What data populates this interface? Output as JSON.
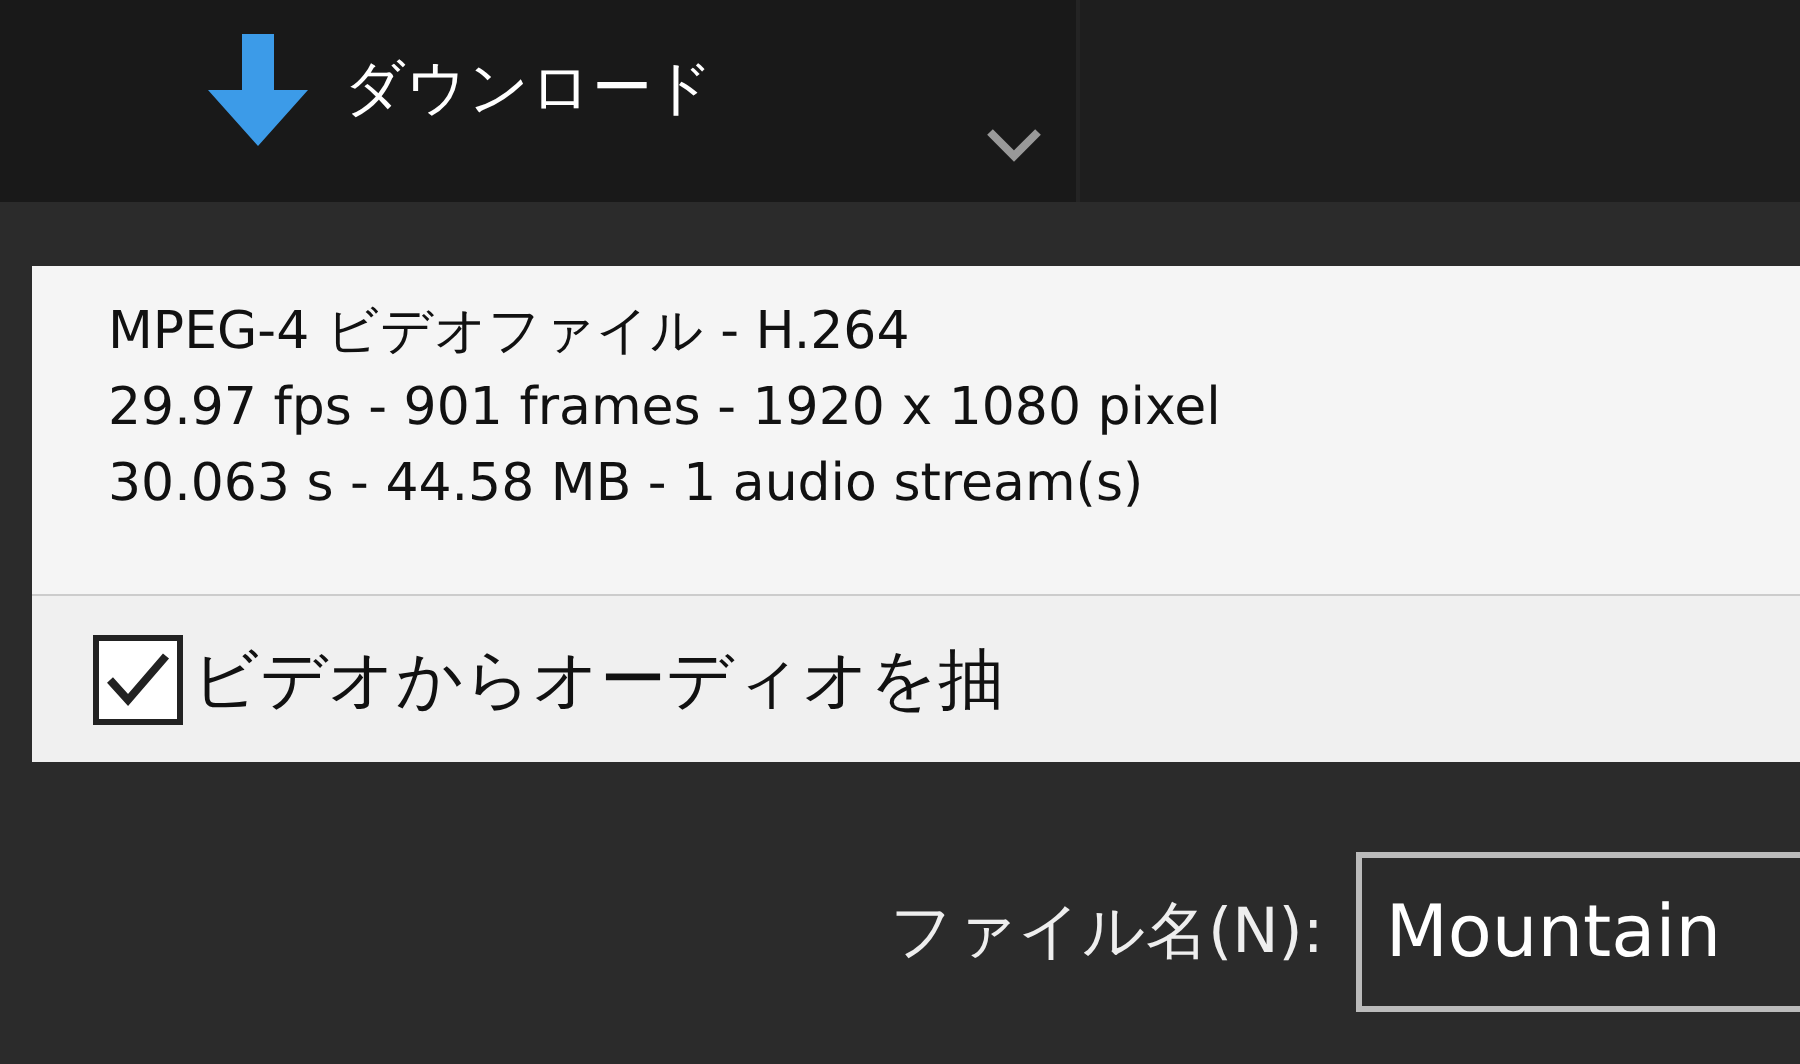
{
  "toolbar": {
    "label": "ダウンロード"
  },
  "file_info": [
    "MPEG-4 ビデオファイル - H.264",
    "29.97 fps - 901 frames - 1920 x 1080 pixel",
    "30.063 s - 44.58 MB - 1 audio stream(s)"
  ],
  "extract_audio": {
    "label": "ビデオからオーディオを抽",
    "checked": true
  },
  "file_name": {
    "label": "ファイル名(N):",
    "value": "Mountain"
  }
}
